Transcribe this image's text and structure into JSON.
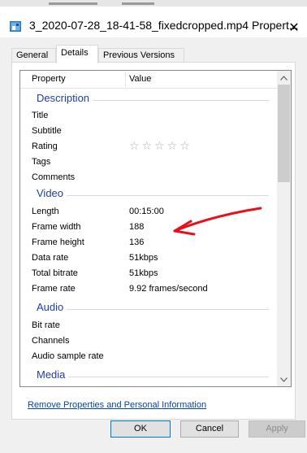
{
  "window": {
    "title": "3_2020-07-28_18-41-58_fixedcropped.mp4 Propert...",
    "close_glyph": "✕"
  },
  "tabs": [
    {
      "label": "General",
      "active": false
    },
    {
      "label": "Details",
      "active": true
    },
    {
      "label": "Previous Versions",
      "active": false
    }
  ],
  "list": {
    "header": {
      "property": "Property",
      "value": "Value"
    },
    "groups": {
      "description": "Description",
      "video": "Video",
      "audio": "Audio",
      "media": "Media"
    },
    "description_rows": [
      {
        "k": "Title",
        "v": ""
      },
      {
        "k": "Subtitle",
        "v": ""
      },
      {
        "k": "Rating",
        "v": ""
      },
      {
        "k": "Tags",
        "v": ""
      },
      {
        "k": "Comments",
        "v": ""
      }
    ],
    "rating_stars": "☆☆☆☆☆",
    "rating_value": 0,
    "video_rows": [
      {
        "k": "Length",
        "v": "00:15:00"
      },
      {
        "k": "Frame width",
        "v": "188"
      },
      {
        "k": "Frame height",
        "v": "136"
      },
      {
        "k": "Data rate",
        "v": "51kbps"
      },
      {
        "k": "Total bitrate",
        "v": "51kbps"
      },
      {
        "k": "Frame rate",
        "v": "9.92 frames/second"
      }
    ],
    "audio_rows": [
      {
        "k": "Bit rate",
        "v": ""
      },
      {
        "k": "Channels",
        "v": ""
      },
      {
        "k": "Audio sample rate",
        "v": ""
      }
    ]
  },
  "link": "Remove Properties and Personal Information",
  "buttons": {
    "ok": "OK",
    "cancel": "Cancel",
    "apply": "Apply"
  },
  "colors": {
    "group_heading": "#1e3ea6",
    "annotation_arrow": "#e8101a",
    "link": "#0645ad"
  }
}
